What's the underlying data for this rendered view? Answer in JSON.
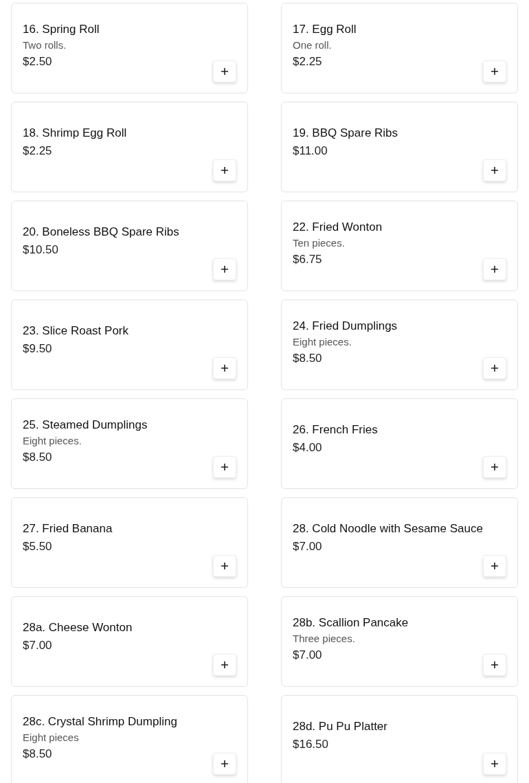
{
  "items": [
    {
      "name": "16. Spring Roll",
      "description": "Two rolls.",
      "price": "$2.50"
    },
    {
      "name": "17. Egg Roll",
      "description": "One roll.",
      "price": "$2.25"
    },
    {
      "name": "18. Shrimp Egg Roll",
      "price": "$2.25"
    },
    {
      "name": "19. BBQ Spare Ribs",
      "price": "$11.00"
    },
    {
      "name": "20. Boneless BBQ Spare Ribs",
      "price": "$10.50"
    },
    {
      "name": "22. Fried Wonton",
      "description": "Ten pieces.",
      "price": "$6.75"
    },
    {
      "name": "23. Slice Roast Pork",
      "price": "$9.50"
    },
    {
      "name": "24. Fried Dumplings",
      "description": "Eight pieces.",
      "price": "$8.50"
    },
    {
      "name": "25. Steamed Dumplings",
      "description": "Eight pieces.",
      "price": "$8.50"
    },
    {
      "name": "26. French Fries",
      "price": "$4.00"
    },
    {
      "name": "27. Fried Banana",
      "price": "$5.50"
    },
    {
      "name": "28. Cold Noodle with Sesame Sauce",
      "price": "$7.00"
    },
    {
      "name": "28a. Cheese Wonton",
      "price": "$7.00"
    },
    {
      "name": "28b. Scallion Pancake",
      "description": "Three pieces.",
      "price": "$7.00"
    },
    {
      "name": "28c. Crystal Shrimp Dumpling",
      "description": "Eight pieces",
      "price": "$8.50"
    },
    {
      "name": "28d. Pu Pu Platter",
      "price": "$16.50"
    }
  ]
}
